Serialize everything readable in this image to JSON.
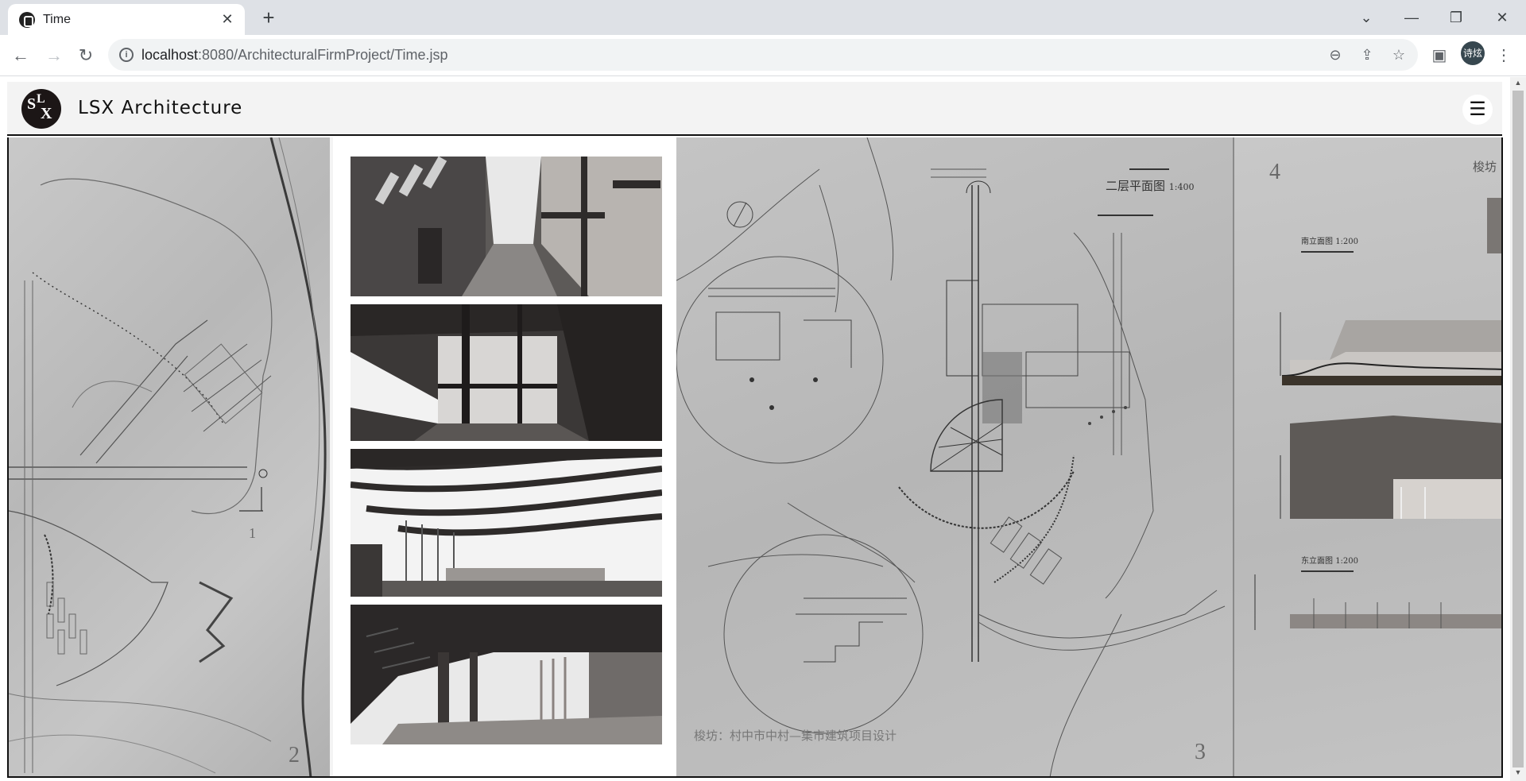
{
  "browser": {
    "tab_title": "Time",
    "url_host": "localhost",
    "url_path": ":8080/ArchitecturalFirmProject/Time.jsp",
    "profile_label": "诗炫"
  },
  "site": {
    "brand": "LSX Architecture",
    "logo_text": "LSX",
    "menu_glyph": "☰"
  },
  "board": {
    "panel_numbers": [
      "2",
      "3",
      "4"
    ],
    "sheet_numbers": [
      "1"
    ],
    "plan_title": "二层平面图",
    "plan_scale": "1:400",
    "south_elevation": "南立面图",
    "south_scale": "1:200",
    "east_elevation": "东立面图",
    "east_scale": "1:200",
    "project_caption": "梭坊：村中市中村—集市建筑项目设计",
    "corner_label": "梭坊"
  }
}
